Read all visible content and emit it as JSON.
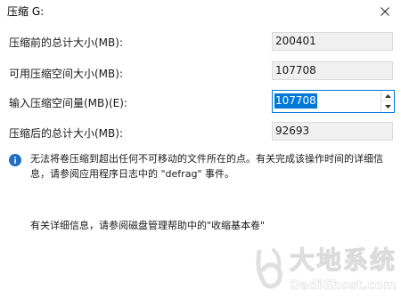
{
  "window": {
    "title": "压缩 G:",
    "close_icon": "close-icon"
  },
  "fields": {
    "total_before": {
      "label": "压缩前的总计大小(MB):",
      "value": "200401"
    },
    "available": {
      "label": "可用压缩空间大小(MB):",
      "value": "107708"
    },
    "shrink_amount": {
      "label": "输入压缩空间量(MB)(E):",
      "value": "107708"
    },
    "total_after": {
      "label": "压缩后的总计大小(MB):",
      "value": "92693"
    }
  },
  "info": {
    "icon": "info-icon",
    "message": "无法将卷压缩到超出任何不可移动的文件所在的点。有关完成该操作时间的详细信息，请参阅应用程序日志中的 \"defrag\" 事件。"
  },
  "help": {
    "text": "有关详细信息，请参阅磁盘管理帮助中的\"收缩基本卷\""
  },
  "watermark": {
    "main": "大地系统",
    "sub": "DadiGhost.com"
  },
  "colors": {
    "accent": "#0078d7",
    "info_icon": "#1f6fc5",
    "readonly_bg": "#f0f0f0"
  }
}
